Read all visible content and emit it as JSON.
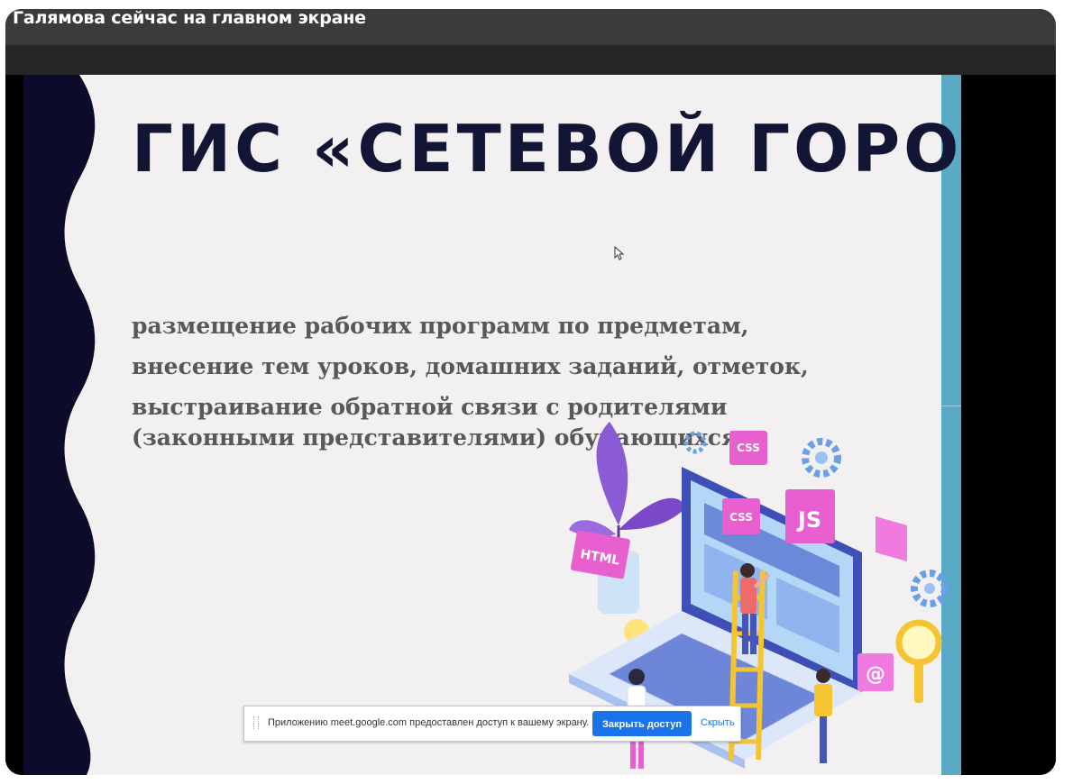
{
  "window": {
    "title": "Галямова сейчас на главном экране"
  },
  "slide": {
    "title": "ГИС «СЕТЕВОЙ ГОРОД»:",
    "bullets": [
      "размещение рабочих программ по предметам,",
      "внесение тем уроков, домашних заданий, отметок,",
      "выстраивание обратной связи с родителями (законными представителями) обучающихся."
    ],
    "illustration": {
      "tags": [
        "HTML",
        "CSS",
        "CSS",
        "JS"
      ]
    },
    "colors": {
      "title": "#121634",
      "wave": "#0c0c2a",
      "accent_bar": "#5aa9c6",
      "slide_bg": "#f2f0f0",
      "pink": "#e85fd0",
      "laptop": "#3f4fb8"
    }
  },
  "share_bar": {
    "message": "Приложению meet.google.com предоставлен доступ к вашему экрану.",
    "stop_label": "Закрыть доступ",
    "hide_label": "Скрыть",
    "button_color": "#1a73e8"
  },
  "icons": [
    "mouse-cursor-icon",
    "drag-handle-icon",
    "gear-icon",
    "magnifier-icon",
    "at-sign-icon",
    "lightbulb-icon",
    "chat-bubble-icon"
  ]
}
